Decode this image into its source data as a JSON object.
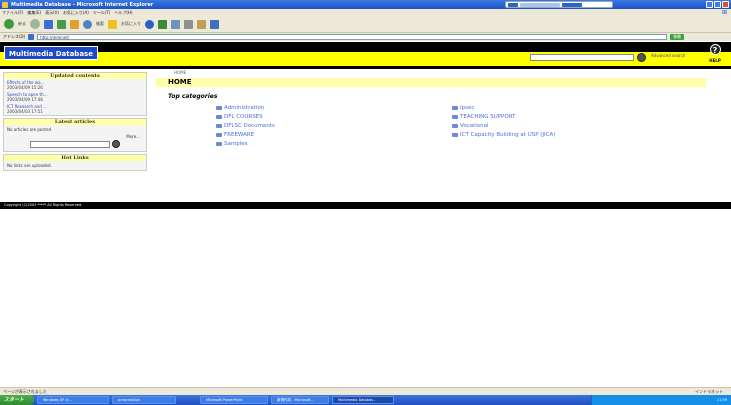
{
  "window": {
    "title": "Multimedia Database - Microsoft Internet Explorer"
  },
  "menu": [
    "ファイル(F)",
    "編集(E)",
    "表示(V)",
    "お気に入り(A)",
    "ツール(T)",
    "ヘルプ(H)"
  ],
  "toolbar": {
    "back_label": "戻る",
    "search_label": "検索",
    "favorites_label": "お気に入り"
  },
  "address": {
    "label": "アドレス(D)",
    "value": "http://mminet/",
    "go_label": "移動"
  },
  "site": {
    "logo": "Multimedia Database",
    "advanced_search": "Advanced search",
    "help_label": "HELP"
  },
  "sidebar": {
    "updated_title": "Updated contents",
    "updated_items": [
      {
        "title": "Effects of the wa...",
        "date": "2003/04/09 15:26"
      },
      {
        "title": "Speech to open th...",
        "date": "2003/04/09 17:48"
      },
      {
        "title": "ICT Research and ...",
        "date": "2003/04/03 17:51"
      }
    ],
    "latest_title": "Latest articles",
    "latest_text": "No articles are posted.",
    "more_label": "More...",
    "hot_title": "Hot Links",
    "hot_text": "No links are uploaded."
  },
  "main": {
    "breadcrumb": "HOME",
    "heading": "HOME",
    "top_categories_label": "Top categories",
    "categories_left": [
      "Administration",
      "DFL COURSES",
      "DFLSC Documents",
      "FREEWARE",
      "Samples"
    ],
    "categories_right": [
      "Ipsec",
      "TEACHING SUPPORT",
      "Vocational",
      "ICT Capacity Building at USP (JICA)"
    ]
  },
  "footer": {
    "copyright": "Copyright (C)2003 ***** All Rights Reserved."
  },
  "status": {
    "left": "ページが表示されました",
    "zone": "イントラネット"
  },
  "taskbar": {
    "start_label": "スタート",
    "tasks": [
      "Windows XP の...",
      "presentation",
      "Microsoft PowerPoint",
      "新規作成 - Microsoft...",
      "Multimedia Databas..."
    ],
    "clock": "11:59"
  },
  "colors": {
    "header_yellow": "#ffff00",
    "panel_yellow": "#ffffa6",
    "logo_blue": "#1f48c4",
    "link_blue": "#4a6ed8"
  }
}
